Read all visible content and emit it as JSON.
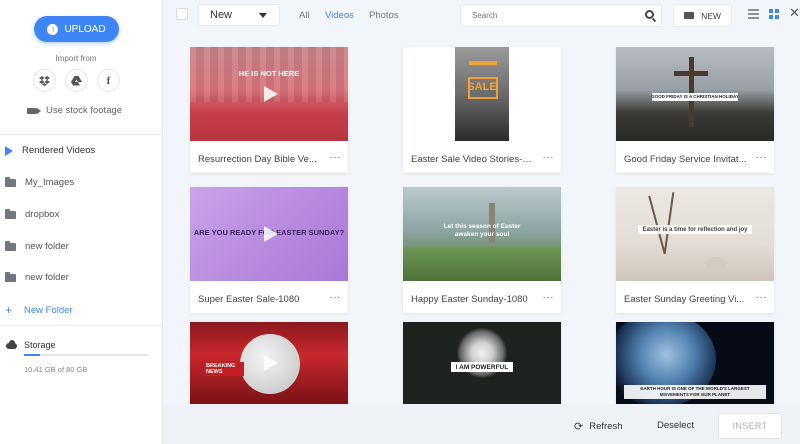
{
  "sidebar": {
    "upload_label": "UPLOAD",
    "import_label": "Import from",
    "import_icons": [
      "dropbox-icon",
      "google-drive-icon",
      "facebook-icon"
    ],
    "stock_label": "Use stock footage",
    "items": [
      {
        "label": "Rendered Videos",
        "icon": "play-icon",
        "active": true
      },
      {
        "label": "My_Images",
        "icon": "folder-open-icon"
      },
      {
        "label": "dropbox",
        "icon": "folder-icon"
      },
      {
        "label": "new folder",
        "icon": "folder-icon"
      },
      {
        "label": "new folder",
        "icon": "folder-icon"
      }
    ],
    "new_folder_label": "New Folder",
    "storage": {
      "label": "Storage",
      "usage_text": "10.41 GB of 80 GB",
      "used_fraction": 0.13
    }
  },
  "topbar": {
    "dropdown_value": "New",
    "filters": [
      "All",
      "Videos",
      "Photos"
    ],
    "active_filter": "Videos",
    "search_placeholder": "Search",
    "new_label": "NEW"
  },
  "cards": [
    {
      "title": "Resurrection Day Bible Ve...",
      "thumb_text": "HE IS NOT HERE"
    },
    {
      "title": "Easter Sale Video Stories-1...",
      "thumb_text": "SALE"
    },
    {
      "title": "Good Friday Service Invitat...",
      "thumb_text": "GOOD FRIDAY IS A CHRISTIAN HOLIDAY"
    },
    {
      "title": "Super Easter Sale-1080",
      "thumb_text": "ARE YOU READY FOR EASTER SUNDAY?"
    },
    {
      "title": "Happy Easter Sunday-1080",
      "thumb_text": "Let this season of Easter awaken your soul"
    },
    {
      "title": "Easter Sunday Greeting Vi...",
      "thumb_text": "Easter is a time for reflection and joy"
    },
    {
      "title": "",
      "thumb_text": "BREAKING NEWS"
    },
    {
      "title": "",
      "thumb_text": "I AM POWERFUL"
    },
    {
      "title": "",
      "thumb_text": "EARTH HOUR IS ONE OF THE WORLD'S LARGEST MOVEMENTS FOR OUR PLANET"
    }
  ],
  "bottombar": {
    "refresh_label": "Refresh",
    "deselect_label": "Deselect",
    "insert_label": "INSERT"
  },
  "colors": {
    "accent": "#3e86f5",
    "background": "#f2f5f9"
  }
}
